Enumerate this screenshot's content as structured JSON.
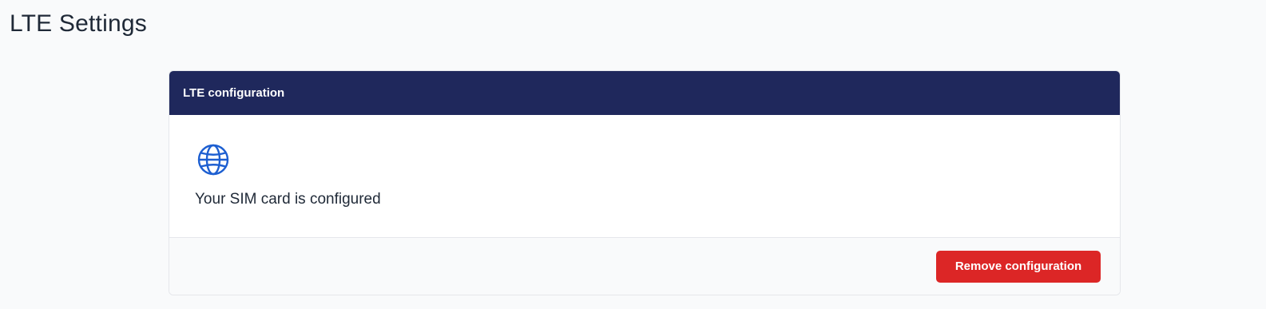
{
  "page": {
    "title": "LTE Settings"
  },
  "card": {
    "header_title": "LTE configuration",
    "icon": "globe-icon",
    "status_message": "Your SIM card is configured",
    "remove_button_label": "Remove configuration"
  },
  "colors": {
    "header_background": "#1f285c",
    "icon": "#1d5fd1",
    "danger_button": "#dc2626",
    "page_background": "#f9fafb"
  }
}
